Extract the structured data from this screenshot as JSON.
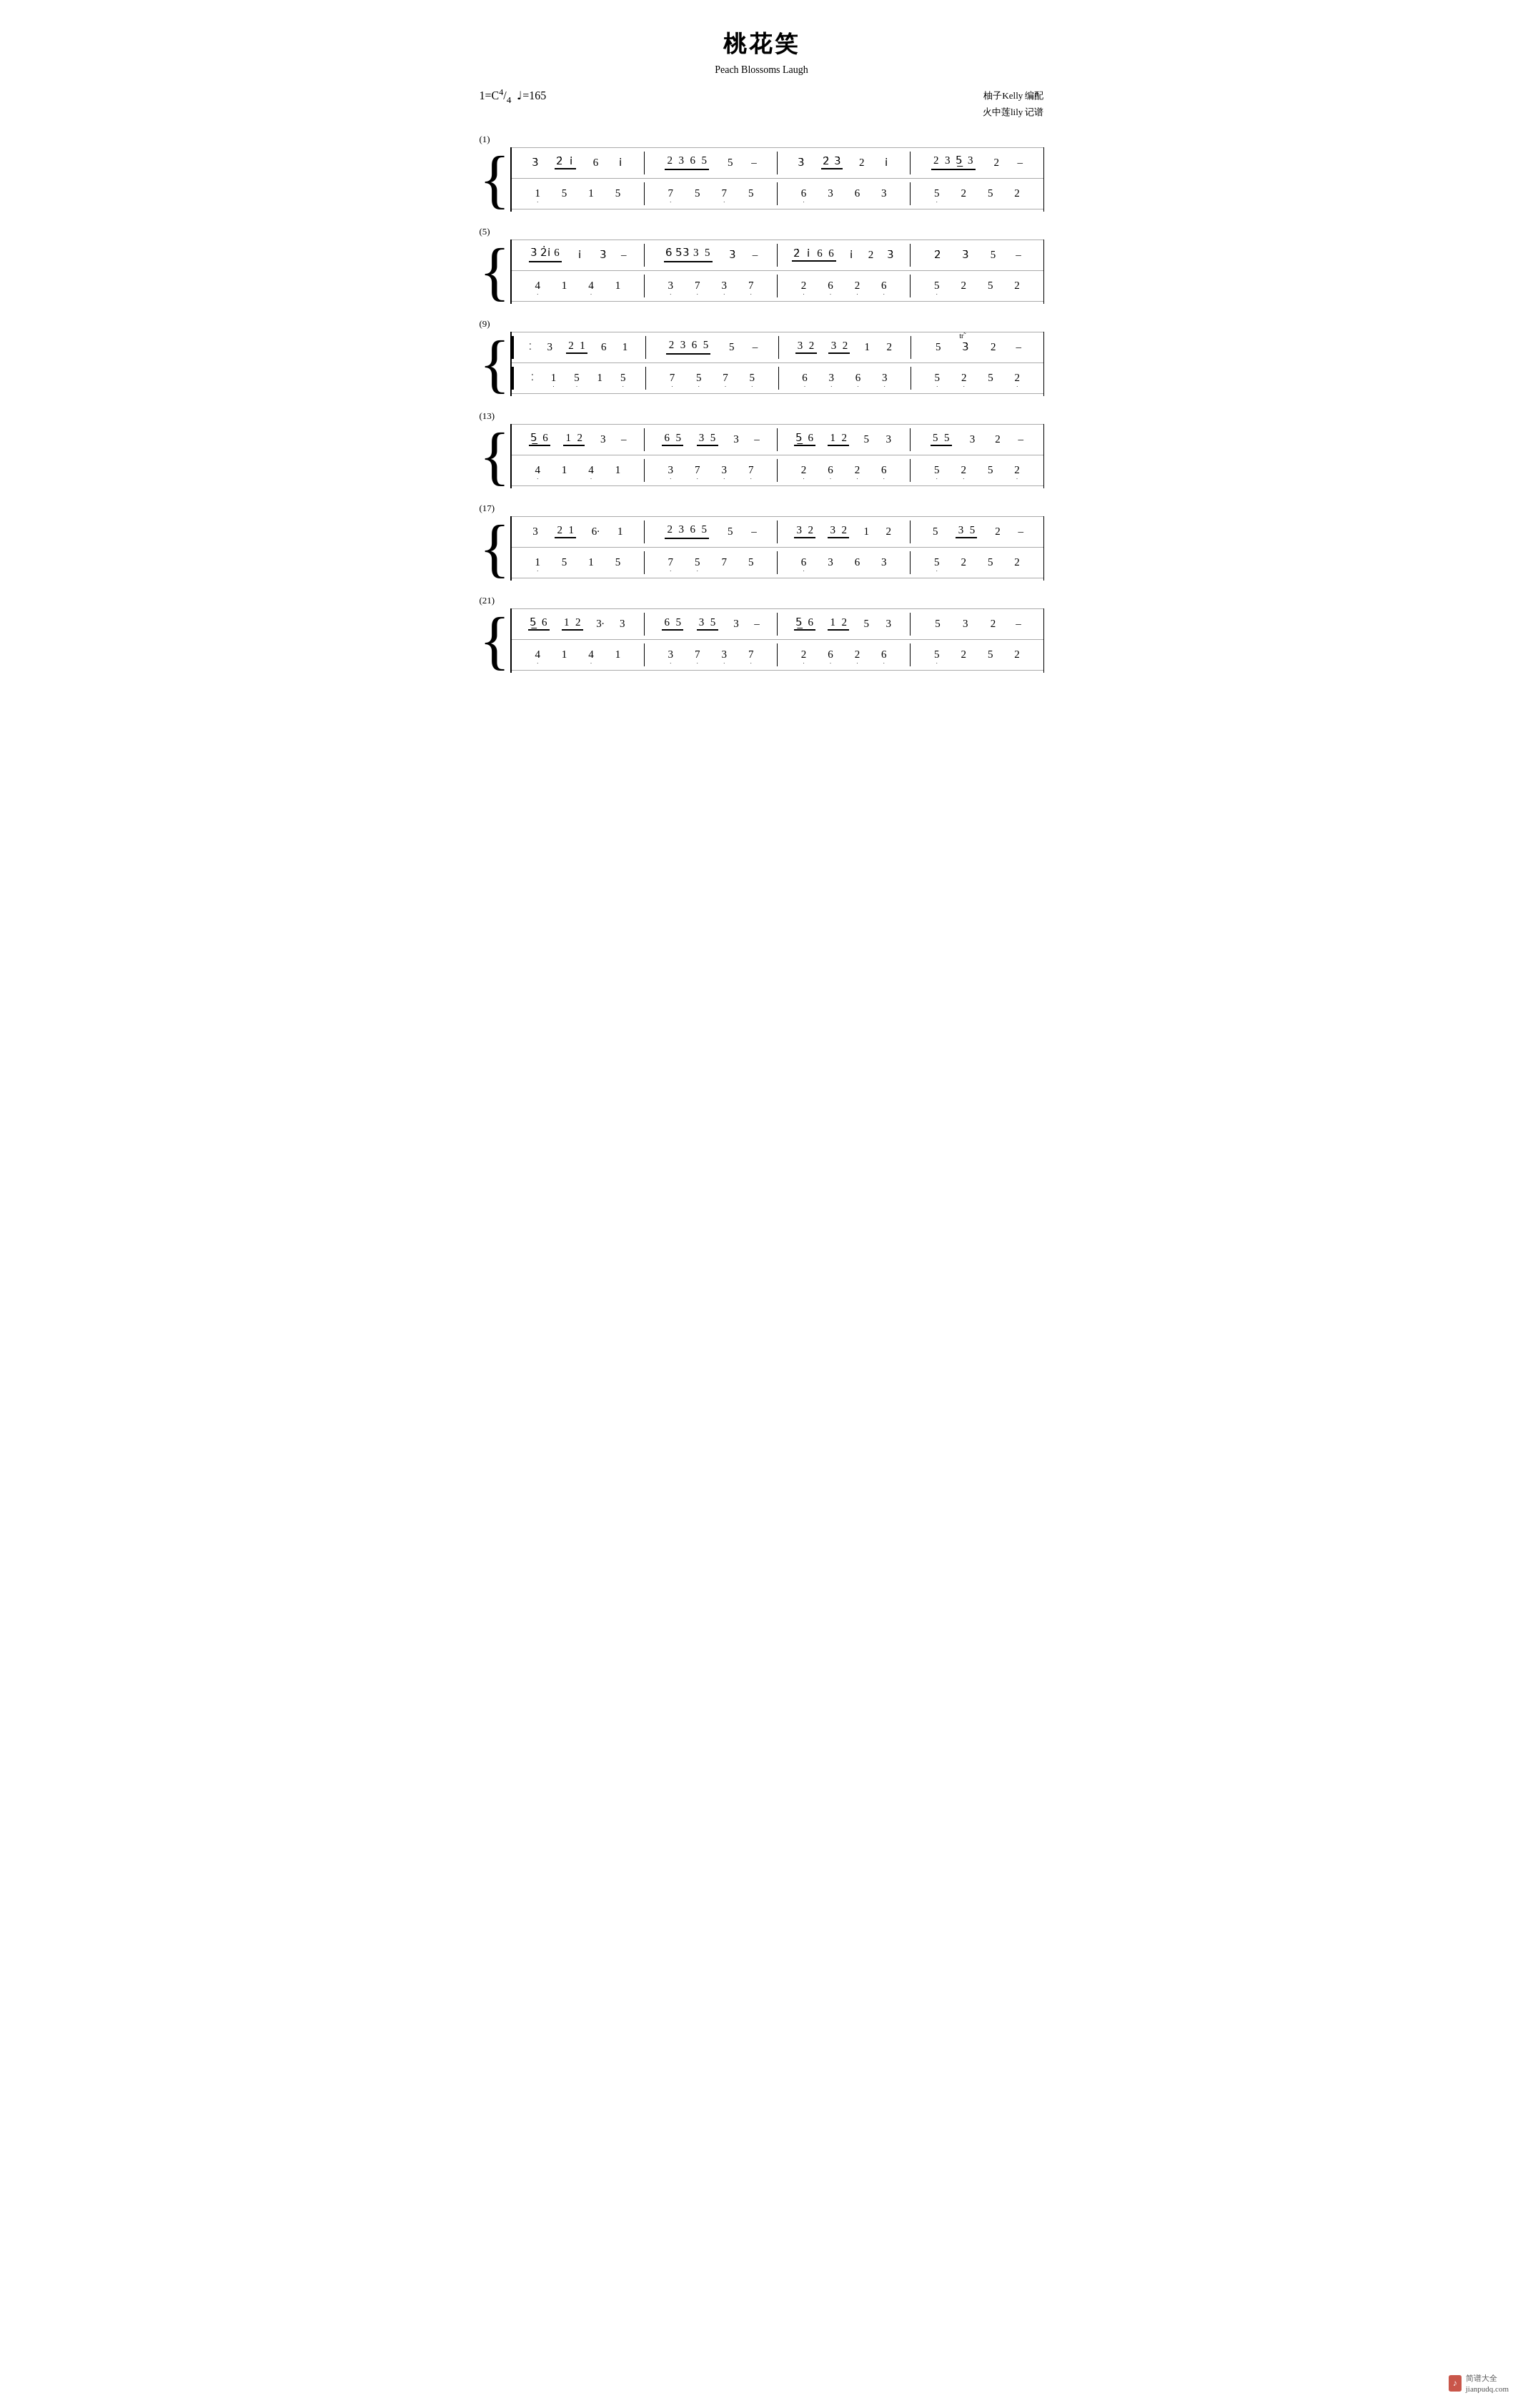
{
  "title": {
    "chinese": "桃花笑",
    "english": "Peach Blossoms Laugh"
  },
  "key": "1=C",
  "time_sig": "4/4",
  "tempo": "♩=165",
  "composer": "柚子Kelly 编配",
  "transcriber": "火中莲lily 记谱",
  "watermark": "简谱大全",
  "site": "jianpudq.com",
  "sections": [
    {
      "label": "(1)"
    },
    {
      "label": "(5)"
    },
    {
      "label": "(9)"
    },
    {
      "label": "(13)"
    },
    {
      "label": "(17)"
    },
    {
      "label": "(21)"
    }
  ]
}
